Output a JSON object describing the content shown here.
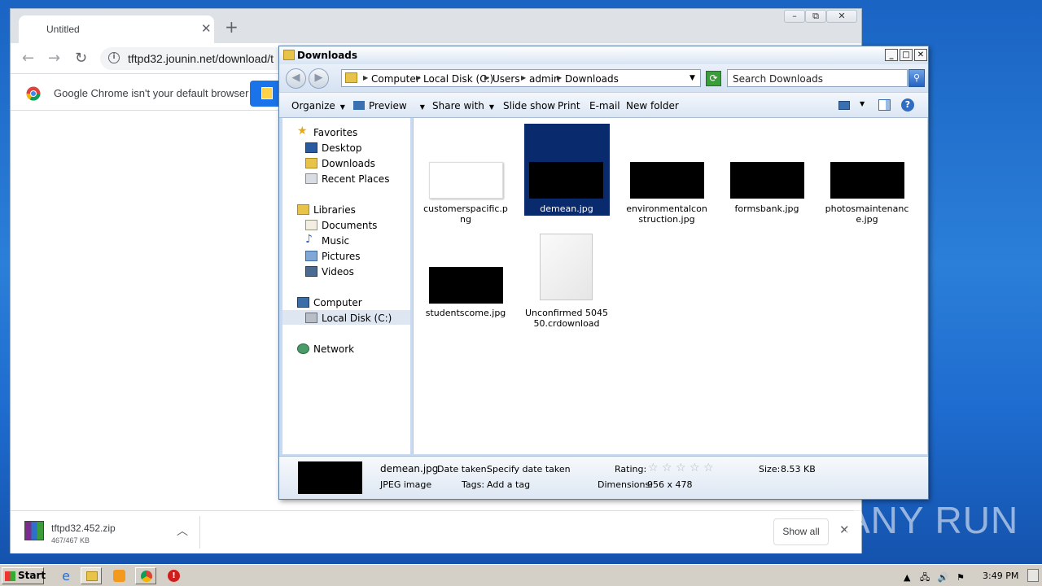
{
  "chrome": {
    "tab_title": "Untitled",
    "url": "tftpd32.jounin.net/download/t",
    "infobar_text": "Google Chrome isn't your default browser",
    "download": {
      "name": "tftpd32.452.zip",
      "size": "467/467 KB"
    },
    "show_all": "Show all"
  },
  "explorer": {
    "title": "Downloads",
    "breadcrumbs": [
      "Computer",
      "Local Disk (C:)",
      "Users",
      "admin",
      "Downloads"
    ],
    "search_placeholder": "Search Downloads",
    "commands": {
      "organize": "Organize",
      "preview": "Preview",
      "share_with": "Share with",
      "slide_show": "Slide show",
      "print": "Print",
      "email": "E-mail",
      "new_folder": "New folder"
    },
    "nav": {
      "favorites": "Favorites",
      "desktop": "Desktop",
      "downloads": "Downloads",
      "recent_places": "Recent Places",
      "libraries": "Libraries",
      "documents": "Documents",
      "music": "Music",
      "pictures": "Pictures",
      "videos": "Videos",
      "computer": "Computer",
      "local_disk": "Local Disk (C:)",
      "network": "Network"
    },
    "files": [
      {
        "name": "customerspacific.png",
        "thumb": "white"
      },
      {
        "name": "demean.jpg",
        "thumb": "black",
        "selected": true
      },
      {
        "name": "environmentalconstruction.jpg",
        "thumb": "black"
      },
      {
        "name": "formsbank.jpg",
        "thumb": "black"
      },
      {
        "name": "photosmaintenance.jpg",
        "thumb": "black"
      },
      {
        "name": "studentscome.jpg",
        "thumb": "black"
      },
      {
        "name": "Unconfirmed 504550.crdownload",
        "thumb": "document"
      }
    ],
    "details": {
      "filename": "demean.jpg",
      "type": "JPEG image",
      "date_label": "Date taken:",
      "date_value": "Specify date taken",
      "tags_label": "Tags:",
      "tags_value": "Add a tag",
      "rating_label": "Rating:",
      "rating_stars": 0,
      "dimensions_label": "Dimensions:",
      "dimensions_value": "956 x 478",
      "size_label": "Size:",
      "size_value": "8.53 KB"
    }
  },
  "taskbar": {
    "start_label": "Start",
    "clock": "3:49 PM"
  },
  "watermark": "ANY RUN",
  "colors": {
    "desktop_blue": "#1e6ccf",
    "selection": "#0a2a6e",
    "chrome_blue": "#1a73e8"
  }
}
